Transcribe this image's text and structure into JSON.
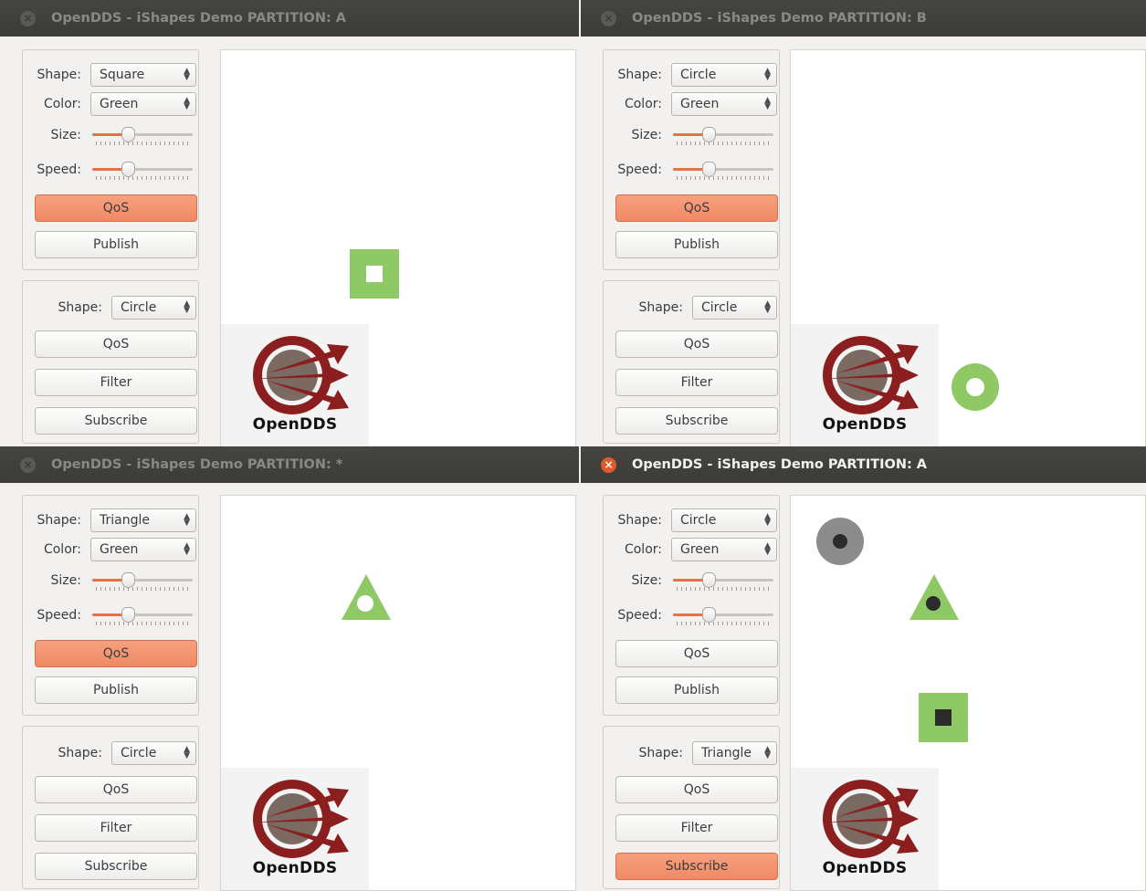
{
  "colors": {
    "accent": "#f08a65",
    "shape_green": "#8fc965",
    "shape_gray": "#8c8c8c",
    "logo_red": "#8b1e1e",
    "titlebar": "#3c3b37"
  },
  "windows": [
    {
      "id": "tl",
      "title": "OpenDDS - iShapes Demo PARTITION: A",
      "active": false,
      "publisher": {
        "shape_label": "Shape:",
        "shape_value": "Square",
        "color_label": "Color:",
        "color_value": "Green",
        "size_label": "Size:",
        "size_level": 0.35,
        "speed_label": "Speed:",
        "speed_level": 0.35,
        "qos_label": "QoS",
        "qos_active": true,
        "publish_label": "Publish"
      },
      "subscriber": {
        "shape_label": "Shape:",
        "shape_value": "Circle",
        "qos_label": "QoS",
        "filter_label": "Filter",
        "subscribe_label": "Subscribe",
        "subscribe_active": false
      },
      "logo_text": "OpenDDS",
      "shapes": [
        {
          "kind": "square",
          "color": "green",
          "inner": "hole"
        }
      ]
    },
    {
      "id": "tr",
      "title": "OpenDDS - iShapes Demo PARTITION: B",
      "active": false,
      "publisher": {
        "shape_label": "Shape:",
        "shape_value": "Circle",
        "color_label": "Color:",
        "color_value": "Green",
        "size_label": "Size:",
        "size_level": 0.35,
        "speed_label": "Speed:",
        "speed_level": 0.35,
        "qos_label": "QoS",
        "qos_active": true,
        "publish_label": "Publish"
      },
      "subscriber": {
        "shape_label": "Shape:",
        "shape_value": "Circle",
        "qos_label": "QoS",
        "filter_label": "Filter",
        "subscribe_label": "Subscribe",
        "subscribe_active": false
      },
      "logo_text": "OpenDDS",
      "shapes": [
        {
          "kind": "circle",
          "color": "green",
          "inner": "hole"
        }
      ]
    },
    {
      "id": "bl",
      "title": "OpenDDS - iShapes Demo PARTITION: *",
      "active": false,
      "publisher": {
        "shape_label": "Shape:",
        "shape_value": "Triangle",
        "color_label": "Color:",
        "color_value": "Green",
        "size_label": "Size:",
        "size_level": 0.35,
        "speed_label": "Speed:",
        "speed_level": 0.35,
        "qos_label": "QoS",
        "qos_active": true,
        "publish_label": "Publish"
      },
      "subscriber": {
        "shape_label": "Shape:",
        "shape_value": "Circle",
        "qos_label": "QoS",
        "filter_label": "Filter",
        "subscribe_label": "Subscribe",
        "subscribe_active": false
      },
      "logo_text": "OpenDDS",
      "shapes": [
        {
          "kind": "triangle",
          "color": "green",
          "inner": "hole"
        }
      ]
    },
    {
      "id": "br",
      "title": "OpenDDS - iShapes Demo PARTITION: A",
      "active": true,
      "publisher": {
        "shape_label": "Shape:",
        "shape_value": "Circle",
        "color_label": "Color:",
        "color_value": "Green",
        "size_label": "Size:",
        "size_level": 0.35,
        "speed_label": "Speed:",
        "speed_level": 0.35,
        "qos_label": "QoS",
        "qos_active": false,
        "publish_label": "Publish"
      },
      "subscriber": {
        "shape_label": "Shape:",
        "shape_value": "Triangle",
        "qos_label": "QoS",
        "filter_label": "Filter",
        "subscribe_label": "Subscribe",
        "subscribe_active": true
      },
      "logo_text": "OpenDDS",
      "shapes": [
        {
          "kind": "circle",
          "color": "gray",
          "inner": "dark-dot"
        },
        {
          "kind": "triangle",
          "color": "green",
          "inner": "dark-dot"
        },
        {
          "kind": "square",
          "color": "green",
          "inner": "dark-square"
        }
      ]
    }
  ]
}
